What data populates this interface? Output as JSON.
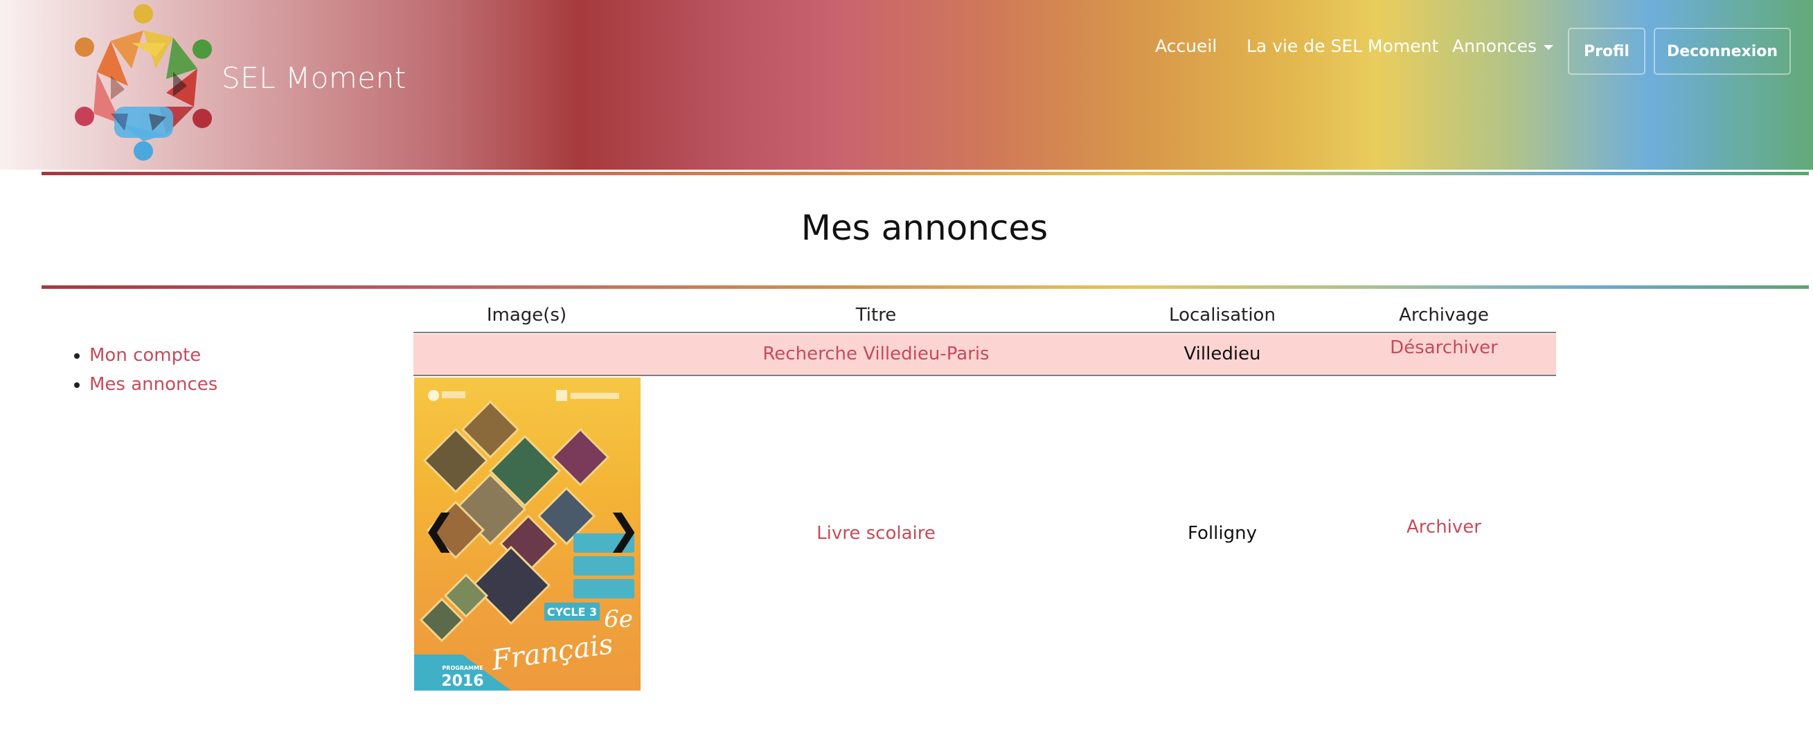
{
  "brand": {
    "name": "SEL Moment"
  },
  "nav": {
    "home": "Accueil",
    "life": "La vie de SEL Moment",
    "ads": "Annonces",
    "profile": "Profil",
    "logout": "Deconnexion"
  },
  "page": {
    "title": "Mes annonces"
  },
  "sidebar": {
    "items": [
      {
        "label": "Mon compte"
      },
      {
        "label": "Mes annonces"
      }
    ]
  },
  "table": {
    "headers": [
      "Image(s)",
      "Titre",
      "Localisation",
      "Archivage"
    ],
    "rows": [
      {
        "title": "Recherche Villedieu-Paris",
        "location": "Villedieu",
        "archive_action": "Désarchiver"
      },
      {
        "title": "Livre scolaire",
        "location": "Folligny",
        "archive_action": "Archiver"
      }
    ]
  },
  "book_cover": {
    "cycle": "CYCLE 3",
    "grade": "6e",
    "subject": "Français",
    "programme": "PROGRAMME",
    "year": "2016"
  },
  "carousel": {
    "prev_icon": "chevron-left-icon",
    "next_icon": "chevron-right-icon"
  },
  "colors": {
    "link": "#c64b5a",
    "highlight_row": "#fcd5d3"
  }
}
